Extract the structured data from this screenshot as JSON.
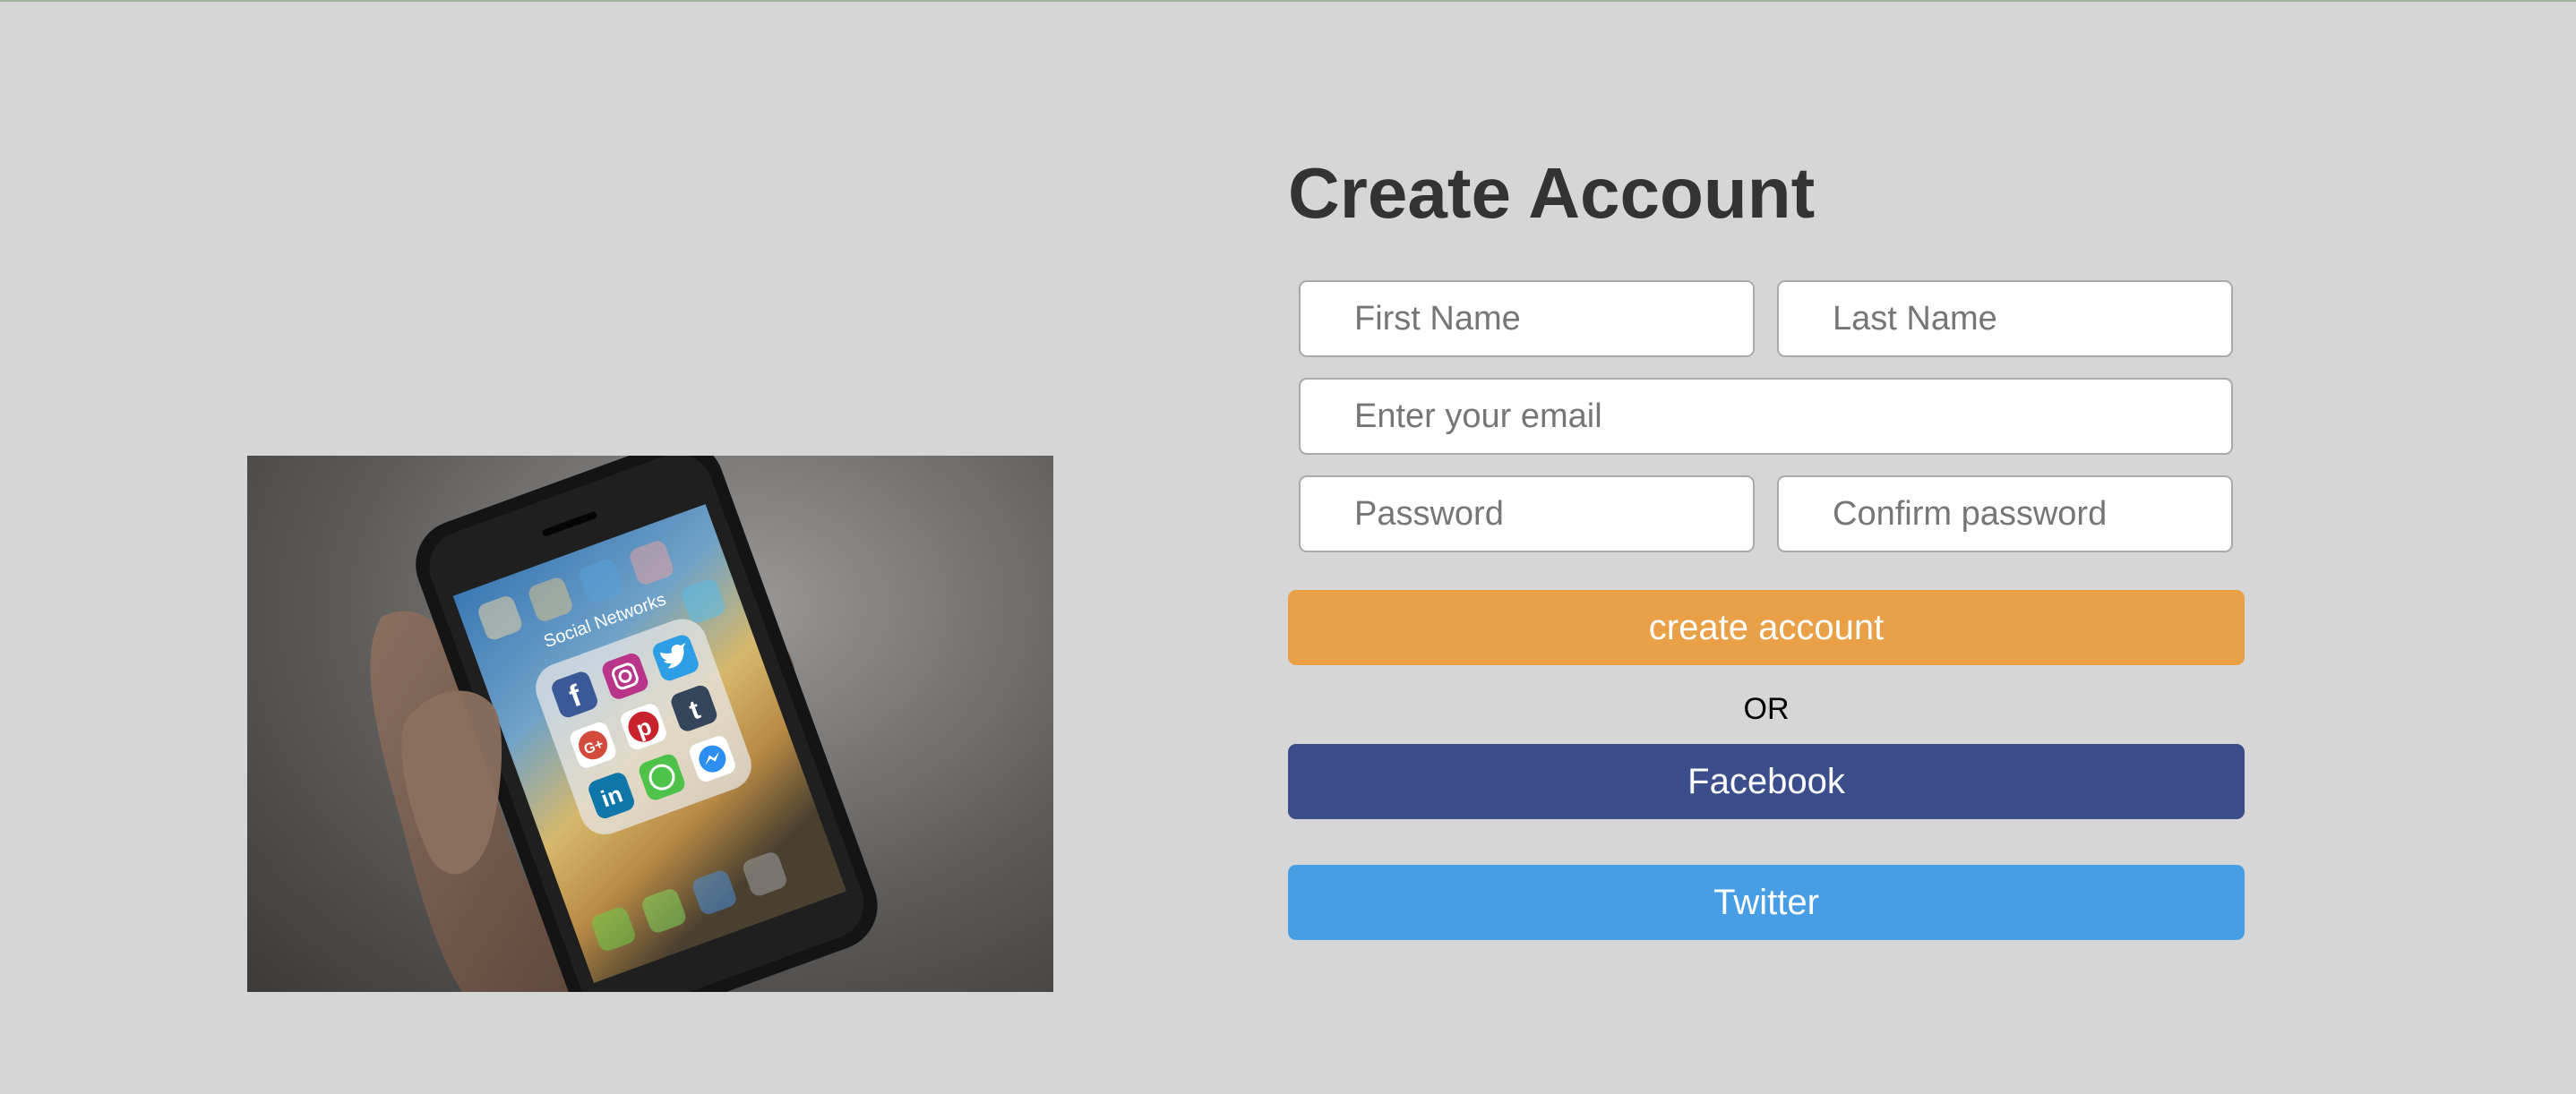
{
  "form": {
    "title": "Create Account",
    "first_name_placeholder": "First Name",
    "last_name_placeholder": "Last Name",
    "email_placeholder": "Enter your email",
    "password_placeholder": "Password",
    "confirm_password_placeholder": "Confirm password",
    "create_label": "create account",
    "or_label": "OR",
    "facebook_label": "Facebook",
    "twitter_label": "Twitter"
  },
  "photo": {
    "folder_label": "Social Networks",
    "apps": [
      "facebook",
      "instagram",
      "twitter",
      "google-plus",
      "pinterest",
      "tumblr",
      "linkedin",
      "whatsapp",
      "messenger"
    ]
  },
  "colors": {
    "background": "#d6d6d6",
    "title": "#333333",
    "create_button": "#e9a046",
    "facebook_button": "#3b4d8b",
    "twitter_button": "#479ee4"
  }
}
